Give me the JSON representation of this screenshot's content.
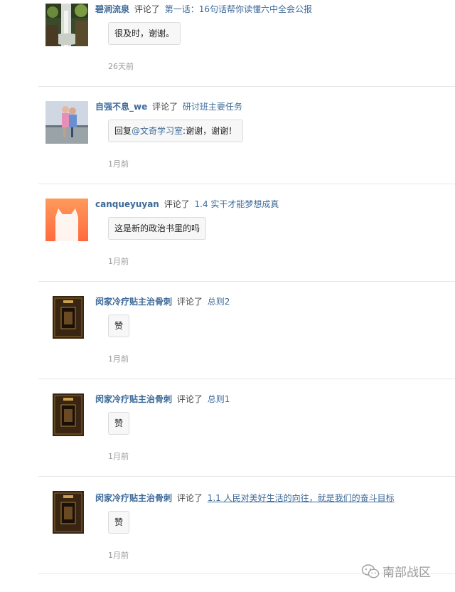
{
  "comments": [
    {
      "username": "碧涧流泉",
      "action": "评论了",
      "target": "第一话：16句话帮你读懂六中全会公报",
      "body": "很及时，谢谢。",
      "time": "26天前",
      "avatar": "waterfall-avatar"
    },
    {
      "username": "自强不息_we",
      "action": "评论了",
      "target": "研讨班主要任务",
      "body_prefix": "回复",
      "mention": "@文奇学习室",
      "body": ":谢谢，谢谢！",
      "time": "1月前",
      "avatar": "couple-photo-avatar"
    },
    {
      "username": "canqueyuyan",
      "action": "评论了",
      "target": "1.4 实干才能梦想成真",
      "body": "这是新的政治书里的吗",
      "time": "1月前",
      "avatar": "cat-default-avatar"
    },
    {
      "username": "闵家冷疗贴主治骨刺",
      "action": "评论了",
      "target": "总则2",
      "body": "赞",
      "time": "1月前",
      "avatar": "product-box-avatar"
    },
    {
      "username": "闵家冷疗贴主治骨刺",
      "action": "评论了",
      "target": "总则1",
      "body": "赞",
      "time": "1月前",
      "avatar": "product-box-avatar"
    },
    {
      "username": "闵家冷疗贴主治骨刺",
      "action": "评论了",
      "target": "1.1 人民对美好生活的向往，就是我们的奋斗目标",
      "body": "赞",
      "time": "1月前",
      "avatar": "product-box-avatar"
    }
  ],
  "watermark": {
    "text": "南部战区",
    "icon": "wechat-icon"
  }
}
